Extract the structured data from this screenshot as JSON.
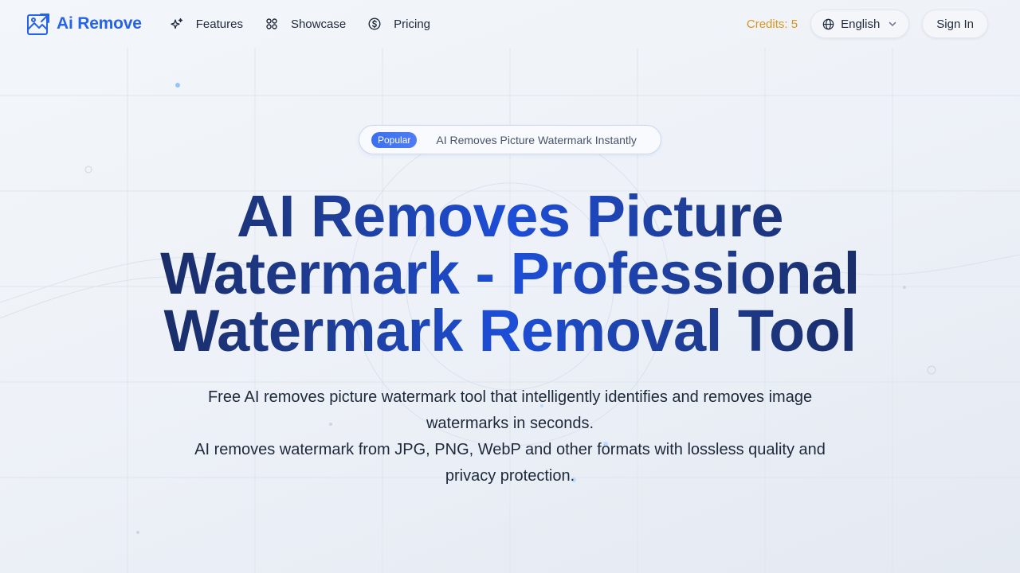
{
  "header": {
    "logo_text": "Ai Remove",
    "nav": [
      {
        "label": "Features",
        "icon": "sparkle-icon"
      },
      {
        "label": "Showcase",
        "icon": "grid-icon"
      },
      {
        "label": "Pricing",
        "icon": "dollar-circle-icon"
      }
    ],
    "credits": "Credits: 5",
    "language": "English",
    "sign_in": "Sign In"
  },
  "hero": {
    "badge": "Popular",
    "badge_text": "AI Removes Picture Watermark Instantly",
    "title": "AI Removes Picture Watermark - Professional Watermark Removal Tool",
    "subtitle_line1": "Free AI removes picture watermark tool that intelligently identifies and removes image watermarks in seconds.",
    "subtitle_line2": "AI removes watermark from JPG, PNG, WebP and other formats with lossless quality and privacy protection."
  },
  "colors": {
    "brand": "#2563eb",
    "credits": "#d9951c",
    "badge": "#3b6ff0",
    "title_dark": "#172554",
    "title_blue": "#1d4ed8"
  }
}
